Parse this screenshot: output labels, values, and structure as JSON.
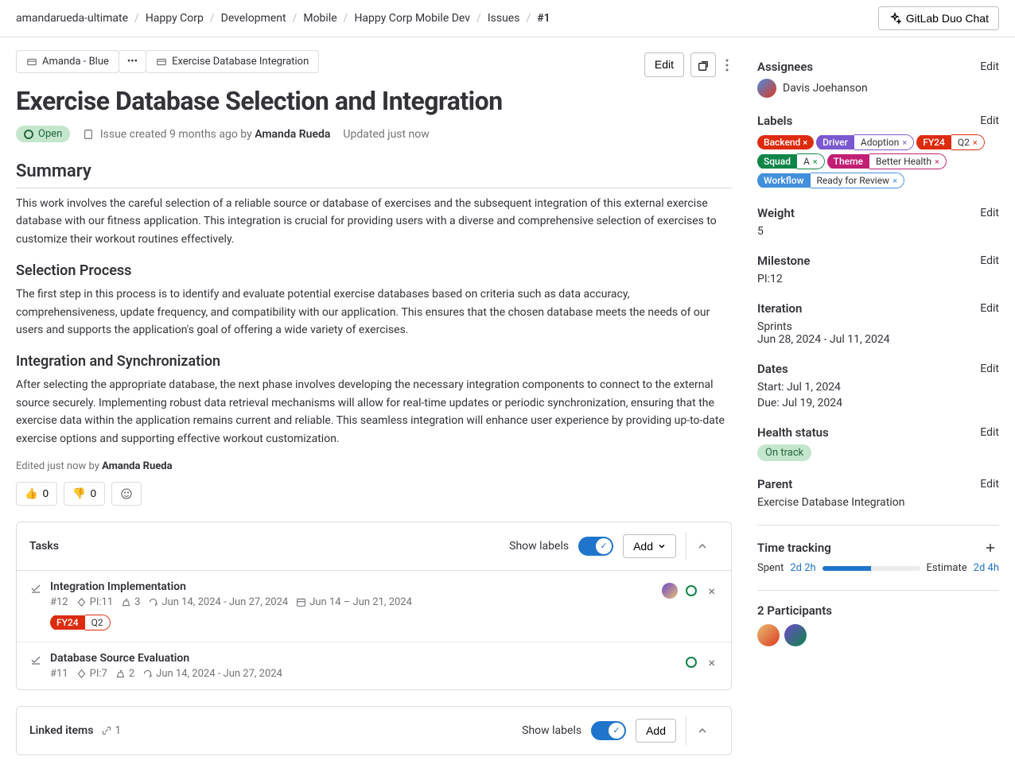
{
  "breadcrumbs": [
    "amandarueda-ultimate",
    "Happy Corp",
    "Development",
    "Mobile",
    "Happy Corp Mobile Dev",
    "Issues",
    "#1"
  ],
  "duo_chat_label": "GitLab Duo Chat",
  "epic_crumbs": {
    "first": "Amanda - Blue",
    "last": "Exercise Database Integration"
  },
  "actions": {
    "edit": "Edit"
  },
  "title": "Exercise Database Selection and Integration",
  "status": "Open",
  "created_text": "Issue created 9 months ago by ",
  "created_author": "Amanda Rueda",
  "updated_text": "Updated just now",
  "desc": {
    "summary_h": "Summary",
    "summary_p": "This work involves the careful selection of a reliable source or database of exercises and the subsequent integration of this external exercise database with our fitness application. This integration is crucial for providing users with a diverse and comprehensive selection of exercises to customize their workout routines effectively.",
    "selection_h": "Selection Process",
    "selection_p": "The first step in this process is to identify and evaluate potential exercise databases based on criteria such as data accuracy, comprehensiveness, update frequency, and compatibility with our application. This ensures that the chosen database meets the needs of our users and supports the application's goal of offering a wide variety of exercises.",
    "integration_h": "Integration and Synchronization",
    "integration_p": "After selecting the appropriate database, the next phase involves developing the necessary integration components to connect to the external source securely. Implementing robust data retrieval mechanisms will allow for real-time updates or periodic synchronization, ensuring that the exercise data within the application remains current and reliable. This seamless integration will enhance user experience by providing up-to-date exercise options and supporting effective workout customization."
  },
  "edited_prefix": "Edited just now by ",
  "edited_author": "Amanda Rueda",
  "reactions": {
    "thumbs_up": "0",
    "thumbs_down": "0"
  },
  "tasks_panel": {
    "title": "Tasks",
    "show_labels": "Show labels",
    "add": "Add"
  },
  "tasks": [
    {
      "title": "Integration Implementation",
      "id": "#12",
      "milestone": "PI:11",
      "weight": "3",
      "iteration": "Jun 14, 2024 - Jun 27, 2024",
      "dates": "Jun 14 – Jun 21, 2024",
      "label_key": "FY24",
      "label_val": "Q2",
      "has_avatar": true
    },
    {
      "title": "Database Source Evaluation",
      "id": "#11",
      "milestone": "PI:7",
      "weight": "2",
      "iteration": "Jun 14, 2024 - Jun 27, 2024",
      "dates": "",
      "label_key": "",
      "label_val": "",
      "has_avatar": false
    }
  ],
  "linked_panel": {
    "title": "Linked items",
    "count": "1",
    "show_labels": "Show labels",
    "add": "Add"
  },
  "sidebar": {
    "assignees_h": "Assignees",
    "assignee": "Davis Joehanson",
    "labels_h": "Labels",
    "labels": [
      {
        "key": "Backend",
        "val": "",
        "bg": "#dd2b0e",
        "fg": "#fff"
      },
      {
        "key": "Driver",
        "val": "Adoption",
        "bg": "#7b58cf",
        "fg": "#fff"
      },
      {
        "key": "FY24",
        "val": "Q2",
        "bg": "#dd2b0e",
        "fg": "#fff"
      },
      {
        "key": "Squad",
        "val": "A",
        "bg": "#108548",
        "fg": "#fff"
      },
      {
        "key": "Theme",
        "val": "Better Health",
        "bg": "#c21e73",
        "fg": "#fff"
      },
      {
        "key": "Workflow",
        "val": "Ready for Review",
        "bg": "#428fdc",
        "fg": "#fff"
      }
    ],
    "weight_h": "Weight",
    "weight": "5",
    "milestone_h": "Milestone",
    "milestone": "PI:12",
    "iteration_h": "Iteration",
    "iteration_name": "Sprints",
    "iteration_dates": "Jun 28, 2024 - Jul 11, 2024",
    "dates_h": "Dates",
    "start": "Start: Jul 1, 2024",
    "due": "Due: Jul 19, 2024",
    "health_h": "Health status",
    "health": "On track",
    "parent_h": "Parent",
    "parent": "Exercise Database Integration",
    "tt_h": "Time tracking",
    "tt_spent_label": "Spent",
    "tt_spent": "2d 2h",
    "tt_est_label": "Estimate",
    "tt_est": "2d 4h",
    "participants_h": "2 Participants",
    "edit": "Edit"
  }
}
